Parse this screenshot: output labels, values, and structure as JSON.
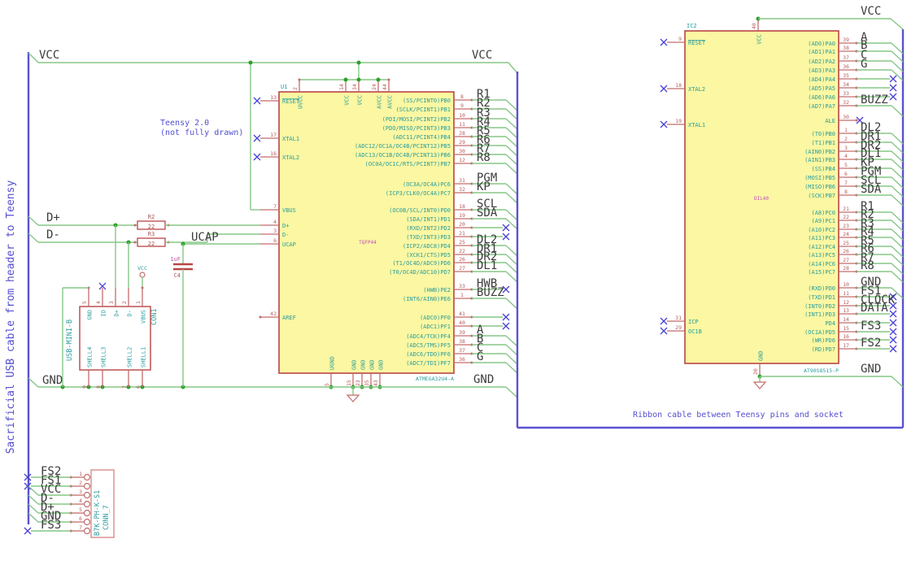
{
  "colors": {
    "wire": "#86c786",
    "junction": "#2ca02c",
    "bus": "#5a52cf",
    "note": "#544fd0",
    "noconnect": "#4a42d4",
    "pin": "#c36c6c",
    "body_border": "#b94545",
    "body_fill": "#fbf7a2",
    "pin_number": "#b85c5c",
    "pin_name": "#2a9d9d",
    "reference": "#2a9d9d",
    "value": "#c04fc0",
    "part_field": "#a85959",
    "label": "#3c3c3c",
    "conn7_border": "#d98c8c"
  },
  "notes": {
    "sacrificial": "Sacrificial USB cable from header to Teensy",
    "teensy_line1": "Teensy 2.0",
    "teensy_line2": "(not fully drawn)",
    "ribbon": "Ribbon cable between Teensy pins and socket"
  },
  "nets": {
    "vcc": "VCC",
    "gnd": "GND",
    "dp": "D+",
    "dm": "D-",
    "ucap": "UCAP"
  },
  "parts": {
    "r2": {
      "ref": "R2",
      "val": "22"
    },
    "r3": {
      "ref": "R3",
      "val": "22"
    },
    "c4": {
      "ref": "C4",
      "val": "1uF"
    },
    "vcc_symbol": "VCC"
  },
  "u1": {
    "reference": "U1",
    "value": "TQFP44",
    "footprint": "ATMEGA32U4-A",
    "left_pins": [
      {
        "num": 13,
        "name": "RESET",
        "conn": "nc"
      },
      {
        "num": 17,
        "name": "XTAL1",
        "conn": "nc"
      },
      {
        "num": 16,
        "name": "XTAL2",
        "conn": "nc"
      },
      {
        "num": 7,
        "name": "VBUS",
        "conn": "wire"
      },
      {
        "num": 4,
        "name": "D+",
        "conn": "wire"
      },
      {
        "num": 3,
        "name": "D-",
        "conn": "wire"
      },
      {
        "num": 6,
        "name": "UCAP",
        "conn": "wire"
      },
      {
        "num": 42,
        "name": "AREF",
        "conn": "stub"
      }
    ],
    "top_pins": [
      {
        "num": 2,
        "name": "UVCC"
      },
      {
        "num": 14,
        "name": "VCC"
      },
      {
        "num": 34,
        "name": "VCC"
      },
      {
        "num": 24,
        "name": "AVCC"
      },
      {
        "num": 44,
        "name": "AVCC"
      }
    ],
    "bottom_pins": [
      {
        "num": 5,
        "name": "UGND"
      },
      {
        "num": 15,
        "name": "GND"
      },
      {
        "num": 23,
        "name": "GND"
      },
      {
        "num": 35,
        "name": "GND"
      },
      {
        "num": 43,
        "name": "GND"
      }
    ],
    "right_pins": [
      {
        "num": 8,
        "name": "(SS/PCINT0)PB0",
        "label": "R1",
        "conn": "bus"
      },
      {
        "num": 9,
        "name": "(SCLK/PCINT1)PB1",
        "label": "R2",
        "conn": "bus"
      },
      {
        "num": 10,
        "name": "(PDI/MOSI/PCINT2)PB2",
        "label": "R3",
        "conn": "bus"
      },
      {
        "num": 11,
        "name": "(PDO/MISO/PCINT3)PB3",
        "label": "R4",
        "conn": "bus"
      },
      {
        "num": 28,
        "name": "(ADC11/PCINT4)PB4",
        "label": "R5",
        "conn": "bus"
      },
      {
        "num": 29,
        "name": "(ADC12/OC1A/OC4B/PCINT12)PB5",
        "label": "R6",
        "conn": "bus"
      },
      {
        "num": 30,
        "name": "(ADC13/OC1B/OC4B/PCINT13)PB6",
        "label": "R7",
        "conn": "bus"
      },
      {
        "num": 12,
        "name": "(OC0A/OC1C/RTS/PCINT7)PB7",
        "label": "R8",
        "conn": "bus"
      },
      {
        "num": 31,
        "name": "(OC3A/OC4A)PC6",
        "label": "PGM",
        "conn": "bus"
      },
      {
        "num": 32,
        "name": "(ICP3/CLK0/OC4A)PC7",
        "label": "KP",
        "conn": "bus"
      },
      {
        "num": 18,
        "name": "(OC0B/SCL/INT0)PD0",
        "label": "SCL",
        "conn": "bus"
      },
      {
        "num": 19,
        "name": "(SDA/INT1)PD1",
        "label": "SDA",
        "conn": "bus"
      },
      {
        "num": 20,
        "name": "(RXD/INT2)PD2",
        "label": "",
        "conn": "nc"
      },
      {
        "num": 21,
        "name": "(TXD/INT3)PD3",
        "label": "",
        "conn": "nc"
      },
      {
        "num": 25,
        "name": "(ICP2/ADC8)PD4",
        "label": "DL2",
        "conn": "bus"
      },
      {
        "num": 22,
        "name": "(XCK1/CTS)PD5",
        "label": "DR1",
        "conn": "bus"
      },
      {
        "num": 26,
        "name": "(T1/OC4D/ADC9)PD6",
        "label": "DR2",
        "conn": "bus"
      },
      {
        "num": 27,
        "name": "(T0/OC4D/ADC10)PD7",
        "label": "DL1",
        "conn": "bus"
      },
      {
        "num": 33,
        "name": "(HWB)PE2",
        "label": "HWB",
        "conn": "nc"
      },
      {
        "num": 1,
        "name": "(INT6/AIN0)PE6",
        "label": "BUZZ",
        "conn": "bus"
      },
      {
        "num": 41,
        "name": "(ADC0)PF0",
        "label": "",
        "conn": "nc"
      },
      {
        "num": 40,
        "name": "(ADC1)PF1",
        "label": "",
        "conn": "nc"
      },
      {
        "num": 39,
        "name": "(ADC4/TCK)PF4",
        "label": "A",
        "conn": "bus"
      },
      {
        "num": 38,
        "name": "(ADC5/TMS)PF5",
        "label": "B",
        "conn": "bus"
      },
      {
        "num": 37,
        "name": "(ADC6/TDO)PF6",
        "label": "C",
        "conn": "bus"
      },
      {
        "num": 36,
        "name": "(ADC7/TDI)PF7",
        "label": "G",
        "conn": "bus"
      }
    ]
  },
  "ic2": {
    "reference": "IC2",
    "value": "DIL40",
    "footprint": "AT90S8515-P",
    "top_pin": {
      "num": 40,
      "name": "VCC"
    },
    "bottom_pin": {
      "num": 20,
      "name": "GND"
    },
    "left_pins": [
      {
        "num": 9,
        "name": "RESET",
        "conn": "nc"
      },
      {
        "num": 18,
        "name": "XTAL2",
        "conn": "nc"
      },
      {
        "num": 19,
        "name": "XTAL1",
        "conn": "nc"
      },
      {
        "num": 31,
        "name": "ICP",
        "conn": "nc"
      },
      {
        "num": 29,
        "name": "OC1B",
        "conn": "nc"
      }
    ],
    "right_pins": [
      {
        "num": 39,
        "name": "(AD0)PA0",
        "label": "A",
        "conn": "bus"
      },
      {
        "num": 38,
        "name": "(AD1)PA1",
        "label": "B",
        "conn": "bus"
      },
      {
        "num": 37,
        "name": "(AD2)PA2",
        "label": "C",
        "conn": "bus"
      },
      {
        "num": 36,
        "name": "(AD3)PA3",
        "label": "G",
        "conn": "bus"
      },
      {
        "num": 35,
        "name": "(AD4)PA4",
        "label": "",
        "conn": "nc"
      },
      {
        "num": 34,
        "name": "(AD5)PA5",
        "label": "",
        "conn": "nc"
      },
      {
        "num": 33,
        "name": "(AD6)PA6",
        "label": "",
        "conn": "nc"
      },
      {
        "num": 32,
        "name": "(AD7)PA7",
        "label": "BUZZ",
        "conn": "bus"
      },
      {
        "num": 30,
        "name": "ALE",
        "label": "",
        "conn": "ncshort"
      },
      {
        "num": 1,
        "name": "(T0)PB0",
        "label": "DL2",
        "conn": "bus"
      },
      {
        "num": 2,
        "name": "(T1)PB1",
        "label": "DR1",
        "conn": "bus"
      },
      {
        "num": 3,
        "name": "(AIN0)PB2",
        "label": "DR2",
        "conn": "bus"
      },
      {
        "num": 4,
        "name": "(AIN1)PB3",
        "label": "DL1",
        "conn": "bus"
      },
      {
        "num": 5,
        "name": "(SS)PB4",
        "label": "KP",
        "conn": "bus"
      },
      {
        "num": 6,
        "name": "(MOSI)PB5",
        "label": "PGM",
        "conn": "bus"
      },
      {
        "num": 7,
        "name": "(MISO)PB6",
        "label": "SCL",
        "conn": "bus"
      },
      {
        "num": 8,
        "name": "(SCK)PB7",
        "label": "SDA",
        "conn": "bus"
      },
      {
        "num": 21,
        "name": "(A8)PC0",
        "label": "R1",
        "conn": "bus"
      },
      {
        "num": 22,
        "name": "(A9)PC1",
        "label": "R2",
        "conn": "bus"
      },
      {
        "num": 23,
        "name": "(A10)PC2",
        "label": "R3",
        "conn": "bus"
      },
      {
        "num": 24,
        "name": "(A11)PC3",
        "label": "R4",
        "conn": "bus"
      },
      {
        "num": 25,
        "name": "(A12)PC4",
        "label": "R5",
        "conn": "bus"
      },
      {
        "num": 26,
        "name": "(A13)PC5",
        "label": "R6",
        "conn": "bus"
      },
      {
        "num": 27,
        "name": "(A14)PC6",
        "label": "R7",
        "conn": "bus"
      },
      {
        "num": 28,
        "name": "(A15)PC7",
        "label": "R8",
        "conn": "bus"
      },
      {
        "num": 10,
        "name": "(RXD)PD0",
        "label": "GND",
        "conn": "bus"
      },
      {
        "num": 11,
        "name": "(TXD)PD1",
        "label": "FS1",
        "conn": "nc"
      },
      {
        "num": 12,
        "name": "(INT0)PD2",
        "label": "CLOCK",
        "conn": "nc"
      },
      {
        "num": 13,
        "name": "(INT1)PD3",
        "label": "DATA",
        "conn": "nc"
      },
      {
        "num": 14,
        "name": "PD4",
        "label": "",
        "conn": "nc"
      },
      {
        "num": 15,
        "name": "(OC1A)PD5",
        "label": "FS3",
        "conn": "nc"
      },
      {
        "num": 16,
        "name": "(WR)PD6",
        "label": "",
        "conn": "nc"
      },
      {
        "num": 17,
        "name": "(RD)PD7",
        "label": "FS2",
        "conn": "nc"
      }
    ]
  },
  "con1": {
    "reference": "CON1",
    "value": "USB-MINI-B",
    "top_pins": [
      {
        "num": 5,
        "name": "GND"
      },
      {
        "num": 4,
        "name": "ID"
      },
      {
        "num": 3,
        "name": "D+"
      },
      {
        "num": 2,
        "name": "D-"
      },
      {
        "num": 1,
        "name": "VBUS"
      }
    ],
    "bottom_pins": [
      {
        "num": 9,
        "name": "SHELL4"
      },
      {
        "num": 8,
        "name": "SHELL3"
      },
      {
        "num": 7,
        "name": "SHELL2"
      },
      {
        "num": 6,
        "name": "SHELL1"
      }
    ]
  },
  "conn7": {
    "reference": "CONN_7",
    "value": "B7K-PH-K-S1",
    "pins": [
      {
        "num": 1,
        "label": "FS2",
        "conn": "nc"
      },
      {
        "num": 2,
        "label": "FS1",
        "conn": "nc"
      },
      {
        "num": 3,
        "label": "VCC",
        "conn": "bus"
      },
      {
        "num": 4,
        "label": "D-",
        "conn": "bus"
      },
      {
        "num": 5,
        "label": "D+",
        "conn": "bus"
      },
      {
        "num": 6,
        "label": "GND",
        "conn": "bus"
      },
      {
        "num": 7,
        "label": "FS3",
        "conn": "nc"
      }
    ]
  }
}
